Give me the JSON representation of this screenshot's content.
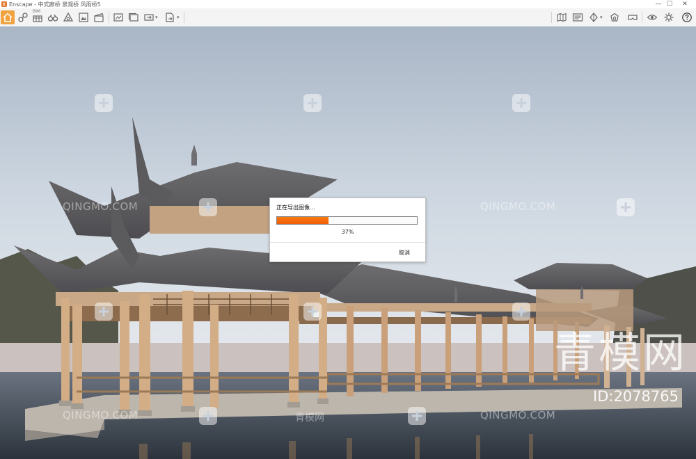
{
  "window": {
    "title": "Enscape - 中式廊桥 景观桥 风雨桥5",
    "minimize_symbol": "—",
    "maximize_symbol": "☐",
    "close_symbol": "✕"
  },
  "toolbar": {
    "bim_label": "BIM",
    "dropdown_caret": "▾",
    "left_icons": [
      "home-icon",
      "link-icon",
      "bim-icon",
      "orbit-icon",
      "binoculars-icon",
      "measure-icon",
      "visual-settings-icon",
      "clapper-icon",
      "render-image-icon",
      "batch-render-icon",
      "export-icon",
      "web-export-icon"
    ],
    "right_icons": [
      "map-icon",
      "panorama-icon",
      "sun-icon",
      "asset-library-icon",
      "vr-headset-icon",
      "eye-icon",
      "settings-icon",
      "help-icon"
    ],
    "colors": {
      "home_active": "#f2a340"
    }
  },
  "dialog": {
    "title": "正在导出图像...",
    "progress": 0.37,
    "percent_label": "37%",
    "cancel_label": "取消",
    "colors": {
      "progress_fill": "#f46a0a"
    }
  },
  "watermarks": {
    "brand_text": "QINGMO.COM",
    "brand_cn": "青模网",
    "large_text": "青模网",
    "id_text": "ID:2078765"
  }
}
